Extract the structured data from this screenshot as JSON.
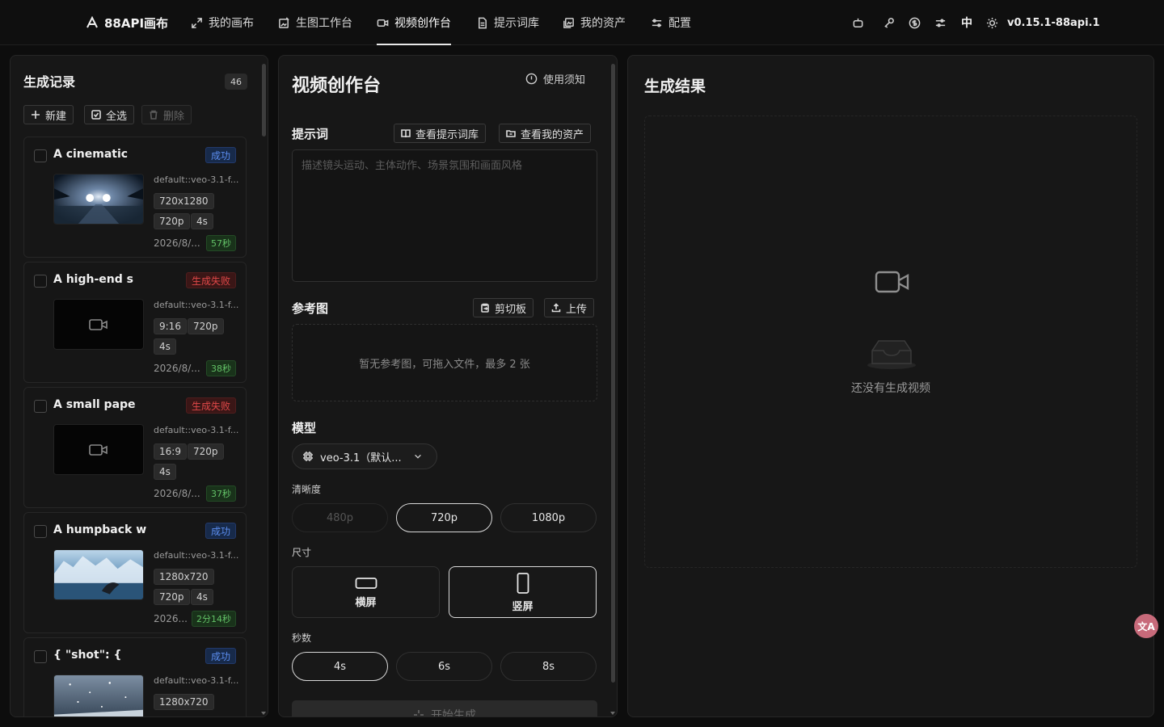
{
  "nav": {
    "brand": "88API画布",
    "items": [
      "我的画布",
      "生图工作台",
      "视频创作台",
      "提示词库",
      "我的资产",
      "配置"
    ],
    "active_index": 2,
    "lang": "中",
    "version": "v0.15.1-88api.1"
  },
  "history": {
    "title": "生成记录",
    "count": "46",
    "new_label": "新建",
    "select_all_label": "全选",
    "delete_label": "删除",
    "records": [
      {
        "title": "A cinematic",
        "status": "成功",
        "status_type": "ok",
        "model": "default::veo-3.1-f...",
        "tags": [
          "720x1280",
          "720p",
          "4s"
        ],
        "date": "2026/8/...",
        "duration": "57秒",
        "thumb": "night-car"
      },
      {
        "title": "A high-end s",
        "status": "生成失败",
        "status_type": "fail",
        "model": "default::veo-3.1-f...",
        "tags": [
          "9:16",
          "720p",
          "4s"
        ],
        "date": "2026/8/...",
        "duration": "38秒",
        "thumb": "none"
      },
      {
        "title": "A small pape",
        "status": "生成失败",
        "status_type": "fail",
        "model": "default::veo-3.1-f...",
        "tags": [
          "16:9",
          "720p",
          "4s"
        ],
        "date": "2026/8/...",
        "duration": "37秒",
        "thumb": "none"
      },
      {
        "title": "A humpback w",
        "status": "成功",
        "status_type": "ok",
        "model": "default::veo-3.1-f...",
        "tags": [
          "1280x720",
          "720p",
          "4s"
        ],
        "date": "2026...",
        "duration": "2分14秒",
        "thumb": "whale"
      },
      {
        "title": "{ \"shot\": {",
        "status": "成功",
        "status_type": "ok",
        "model": "default::veo-3.1-f...",
        "tags": [
          "1280x720"
        ],
        "date": "",
        "duration": "",
        "thumb": "snow"
      }
    ]
  },
  "studio": {
    "title": "视频创作台",
    "usage_notice": "使用须知",
    "prompt_label": "提示词",
    "view_prompt_lib": "查看提示词库",
    "view_my_assets": "查看我的资产",
    "prompt_placeholder": "描述镜头运动、主体动作、场景氛围和画面风格",
    "ref_label": "参考图",
    "clipboard_label": "剪切板",
    "upload_label": "上传",
    "ref_empty": "暂无参考图，可拖入文件，最多 2 张",
    "model_label": "模型",
    "model_value": "veo-3.1（默认...",
    "resolution_label": "清晰度",
    "resolutions": [
      "480p",
      "720p",
      "1080p"
    ],
    "resolution_selected": "720p",
    "resolution_disabled": "480p",
    "size_label": "尺寸",
    "sizes": [
      "横屏",
      "竖屏"
    ],
    "size_selected": "竖屏",
    "seconds_label": "秒数",
    "seconds": [
      "4s",
      "6s",
      "8s"
    ],
    "seconds_selected": "4s",
    "generate_label": "开始生成"
  },
  "result": {
    "title": "生成结果",
    "empty_text": "还没有生成视频"
  },
  "floating_label": "文A"
}
